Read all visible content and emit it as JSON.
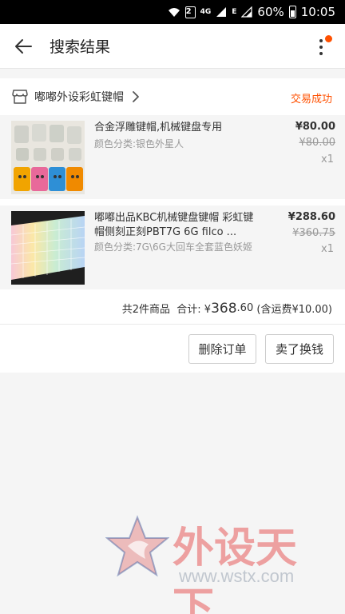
{
  "status_bar": {
    "sim_badge": "2",
    "network_4g": "4G",
    "network_e": "E",
    "battery": "60%",
    "time": "10:05"
  },
  "app_bar": {
    "title": "搜索结果",
    "back_icon": "arrow-left-icon",
    "more_icon": "more-vertical-icon"
  },
  "order": {
    "shop_name": "嘟嘟外设彩虹键帽",
    "status": "交易成功",
    "colors": {
      "accent": "#ff5000"
    },
    "items": [
      {
        "title": "合金浮雕键帽,机械键盘专用",
        "sku": "颜色分类:银色外星人",
        "price": "¥80.00",
        "original_price": "¥80.00",
        "quantity": "x1"
      },
      {
        "title": "嘟嘟出品KBC机械键盘键帽 彩虹键帽侧刻正刻PBT7G 6G filco ...",
        "sku": "颜色分类:7G\\6G大回车全套蓝色妖姬",
        "price": "¥288.60",
        "original_price": "¥360.75",
        "quantity": "x1"
      }
    ],
    "summary": {
      "count_text": "共2件商品",
      "total_label": "合计: ¥",
      "total_int": "368",
      "total_dec": ".60",
      "shipping": " (含运费¥10.00)"
    },
    "actions": {
      "delete": "删除订单",
      "sell": "卖了换钱"
    }
  },
  "watermark": {
    "name": "外设天下",
    "url": "www.wstx.com"
  }
}
